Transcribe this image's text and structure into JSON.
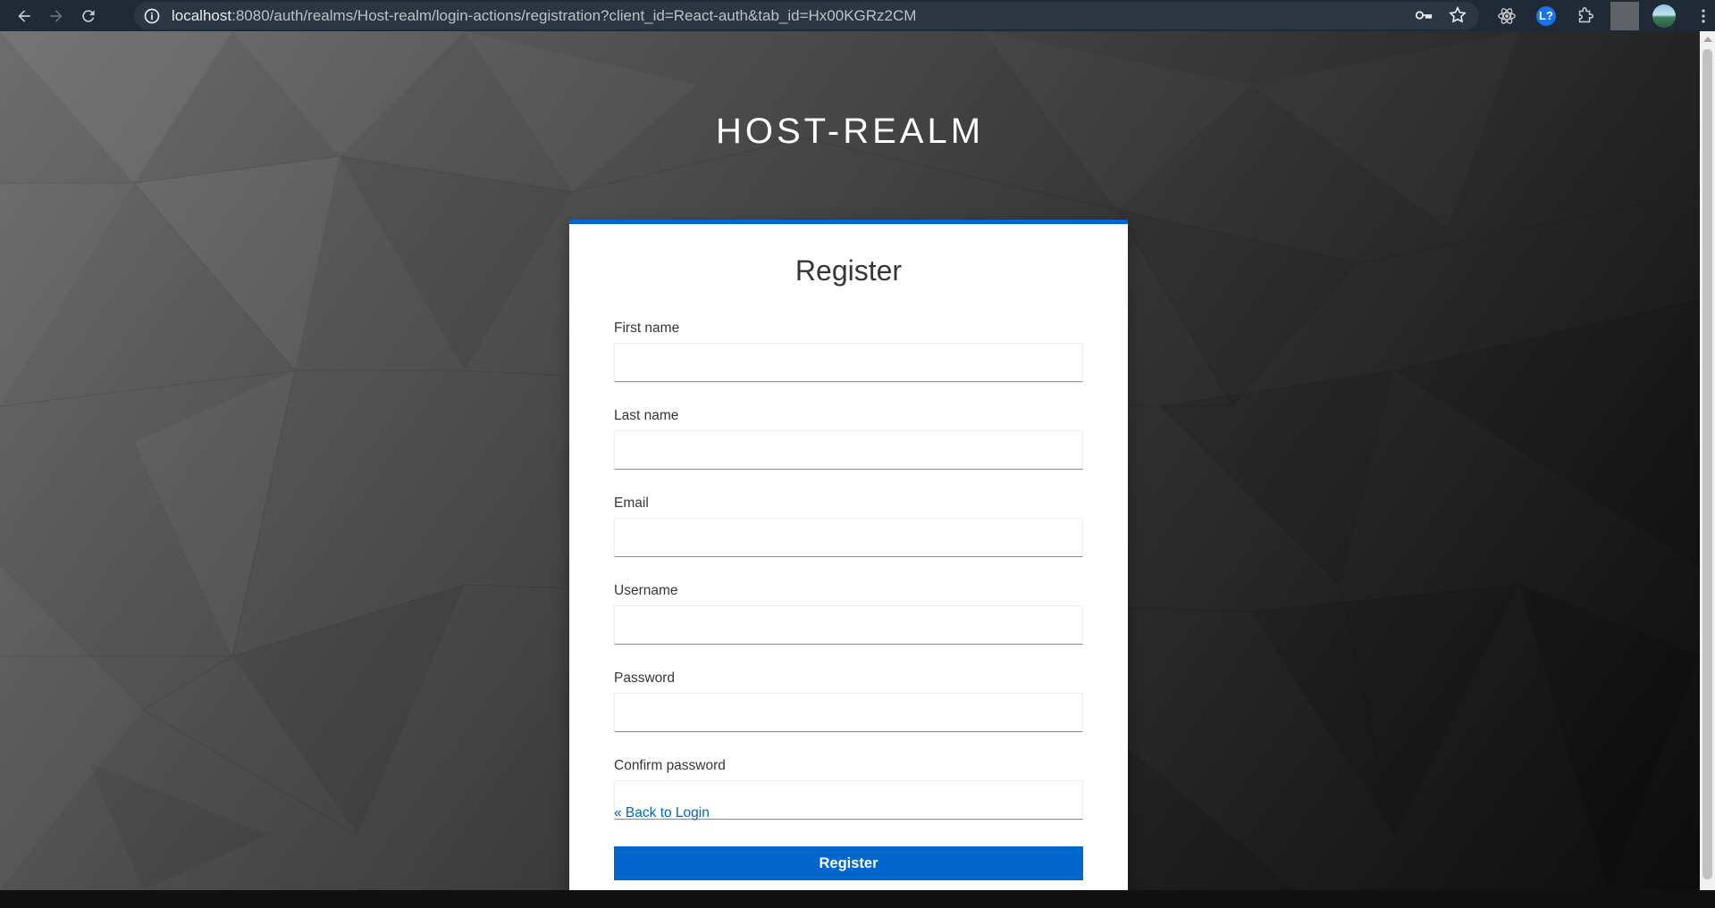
{
  "browser": {
    "url_host": "localhost",
    "url_rest": ":8080/auth/realms/Host-realm/login-actions/registration?client_id=React-auth&tab_id=Hx00KGRz2CM",
    "extension_badge": "L?"
  },
  "page": {
    "realm_title": "HOST-REALM",
    "form_title": "Register",
    "fields": [
      {
        "label": "First name",
        "value": ""
      },
      {
        "label": "Last name",
        "value": ""
      },
      {
        "label": "Email",
        "value": ""
      },
      {
        "label": "Username",
        "value": ""
      },
      {
        "label": "Password",
        "value": ""
      },
      {
        "label": "Confirm password",
        "value": ""
      }
    ],
    "back_link": "« Back to Login",
    "submit_label": "Register"
  },
  "colors": {
    "accent": "#0066cc",
    "browser_bar": "#202a37"
  }
}
